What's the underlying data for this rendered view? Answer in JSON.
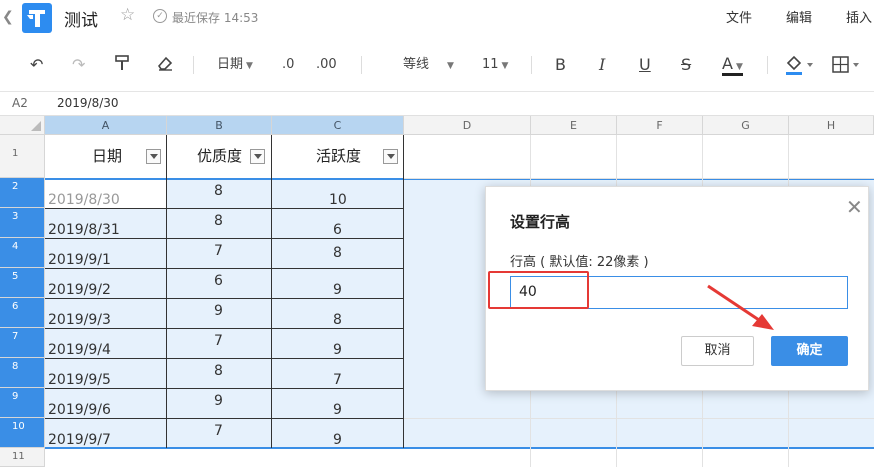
{
  "titlebar": {
    "title": "测试",
    "save_status": "最近保存 14:53",
    "menu": [
      "文件",
      "编辑",
      "插入"
    ]
  },
  "toolbar": {
    "number_format": "日期",
    "decimal_decrease": ".0",
    "decimal_increase": ".00",
    "font_name": "等线",
    "font_size": "11",
    "bold": "B",
    "italic": "I",
    "underline": "U",
    "strike": "S",
    "font_color": "A"
  },
  "formula_bar": {
    "cell_ref": "A2",
    "value": "2019/8/30"
  },
  "grid": {
    "columns": [
      "A",
      "B",
      "C",
      "D",
      "E",
      "F",
      "G",
      "H"
    ],
    "row_numbers": [
      "1",
      "2",
      "3",
      "4",
      "5",
      "6",
      "7",
      "8",
      "9",
      "10",
      "11"
    ],
    "headers": [
      "日期",
      "优质度",
      "活跃度"
    ],
    "rows": [
      [
        "2019/8/30",
        "8",
        "10"
      ],
      [
        "2019/8/31",
        "8",
        "6"
      ],
      [
        "2019/9/1",
        "7",
        "8"
      ],
      [
        "2019/9/2",
        "6",
        "9"
      ],
      [
        "2019/9/3",
        "9",
        "8"
      ],
      [
        "2019/9/4",
        "7",
        "9"
      ],
      [
        "2019/9/5",
        "8",
        "7"
      ],
      [
        "2019/9/6",
        "9",
        "9"
      ],
      [
        "2019/9/7",
        "7",
        "9"
      ]
    ]
  },
  "dialog": {
    "title": "设置行高",
    "label": "行高 ( 默认值: 22像素 )",
    "input_value": "40",
    "cancel_label": "取消",
    "ok_label": "确定"
  },
  "colors": {
    "accent": "#3a8ee6",
    "selection_fill": "#e6f1fc",
    "highlight": "#e53935"
  }
}
